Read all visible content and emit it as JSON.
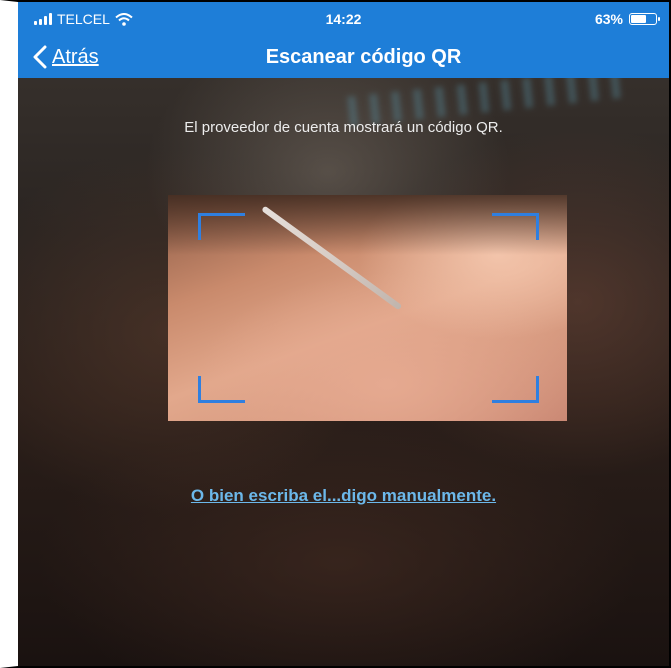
{
  "status_bar": {
    "carrier": "TELCEL",
    "time": "14:22",
    "battery": "63%",
    "battery_level": 0.63,
    "icons": [
      "signal-bars-icon",
      "wifi-icon",
      "battery-icon"
    ]
  },
  "nav": {
    "back_label": "Atrás",
    "back_icon": "chevron-left-icon",
    "title": "Escanear código QR"
  },
  "scanner": {
    "instruction": "El proveedor de cuenta mostrará un código QR.",
    "frame_color": "#2f7fe0"
  },
  "manual_entry_link": "O bien escriba el...digo manualmente.",
  "colors": {
    "accent": "#1e7ed8",
    "link": "#6cb8ea"
  }
}
